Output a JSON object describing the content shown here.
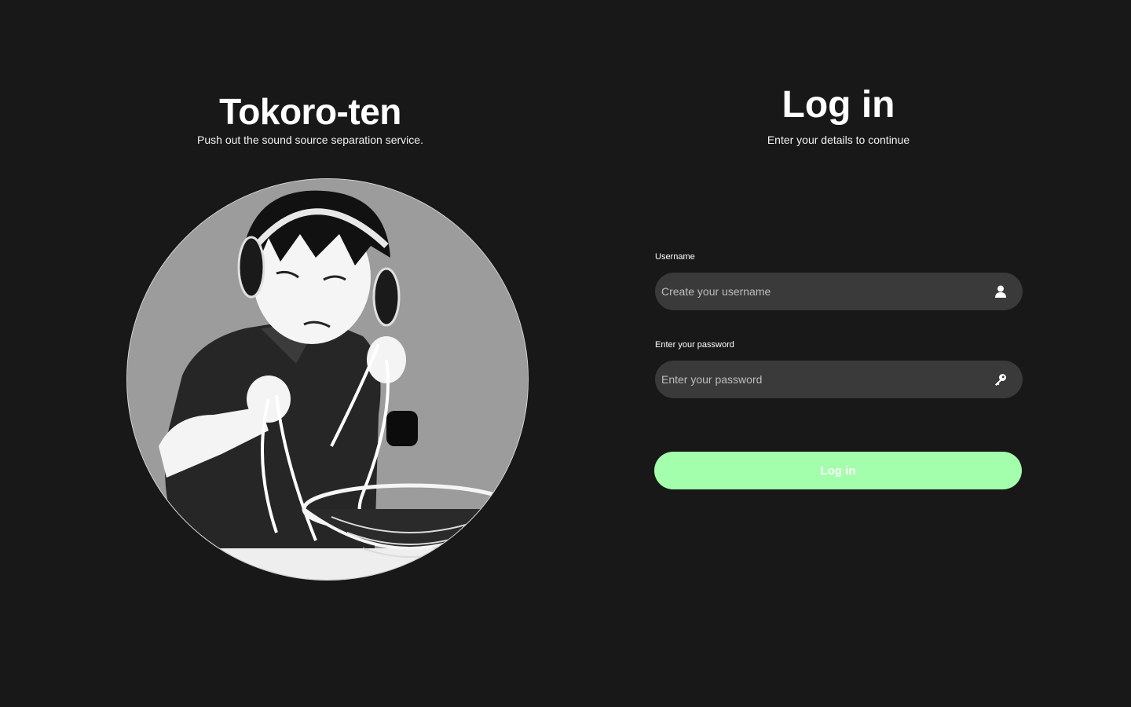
{
  "brand": {
    "title": "Tokoro-ten",
    "subtitle": "Push out the sound source separation service."
  },
  "illustration": {
    "icon": "headphones-boy-illustration"
  },
  "login": {
    "title": "Log in",
    "subtitle": "Enter your details to continue",
    "username": {
      "label": "Username",
      "placeholder": "Create your username",
      "value": "",
      "icon": "user-icon"
    },
    "password": {
      "label": "Enter your password",
      "placeholder": "Enter your password",
      "value": "",
      "icon": "key-icon"
    },
    "submit_label": "Log in"
  },
  "colors": {
    "background": "#181818",
    "field_background": "#3a3a3a",
    "accent": "#a3ffab"
  }
}
